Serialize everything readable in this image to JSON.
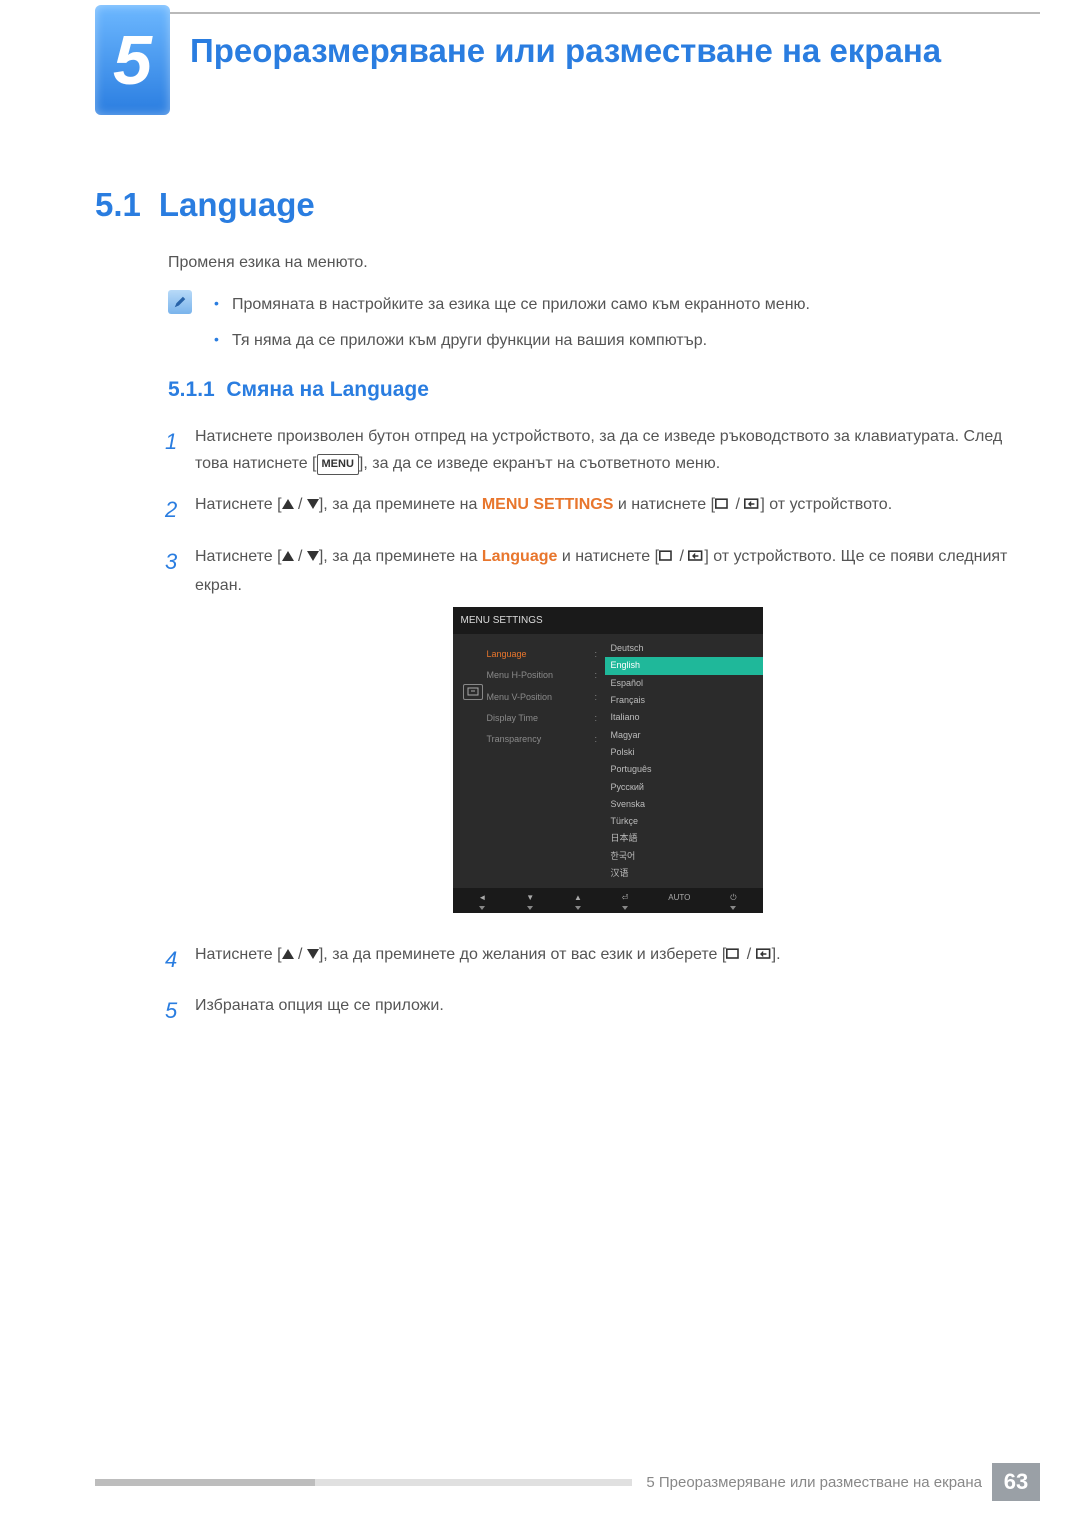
{
  "chapter": {
    "number": "5",
    "title": "Преоразмеряване или разместване на екрана"
  },
  "section": {
    "number": "5.1",
    "title": "Language",
    "intro": "Променя езика на менюто."
  },
  "notes": [
    "Промяната в настройките за езика ще се приложи само към екранното меню.",
    "Тя няма да се приложи към други функции на вашия компютър."
  ],
  "subsection": {
    "number": "5.1.1",
    "title": "Смяна на Language"
  },
  "steps": {
    "s1a": "Натиснете произволен бутон отпред на устройството, за да се изведе ръководството за клавиатурата. След това натиснете [",
    "s1b": "], за да се изведе екранът на съответното меню.",
    "s2a": "Натиснете [",
    "s2b": "], за да преминете на ",
    "s2c": " и натиснете [",
    "s2d": "] от устройството.",
    "s3a": "Натиснете [",
    "s3b": "], за да преминете на ",
    "s3c": " и натиснете [",
    "s3d": "] от устройството. Ще се появи следният екран.",
    "s4a": "Натиснете [",
    "s4b": "], за да преминете до желания от вас език и изберете [",
    "s4c": "].",
    "s5": "Избраната опция ще се приложи.",
    "menu_settings": "MENU SETTINGS",
    "language_word": "Language",
    "menu_label": "MENU"
  },
  "osd": {
    "title": "MENU SETTINGS",
    "left": [
      "Language",
      "Menu H-Position",
      "Menu V-Position",
      "Display Time",
      "Transparency"
    ],
    "right": [
      "Deutsch",
      "English",
      "Español",
      "Français",
      "Italiano",
      "Magyar",
      "Polski",
      "Português",
      "Русский",
      "Svenska",
      "Türkçe",
      "日本語",
      "한국어",
      "汉语"
    ],
    "selected_index": 1,
    "footer_auto": "AUTO"
  },
  "footer": {
    "text": "5 Преоразмеряване или разместване на екрана",
    "page": "63"
  }
}
